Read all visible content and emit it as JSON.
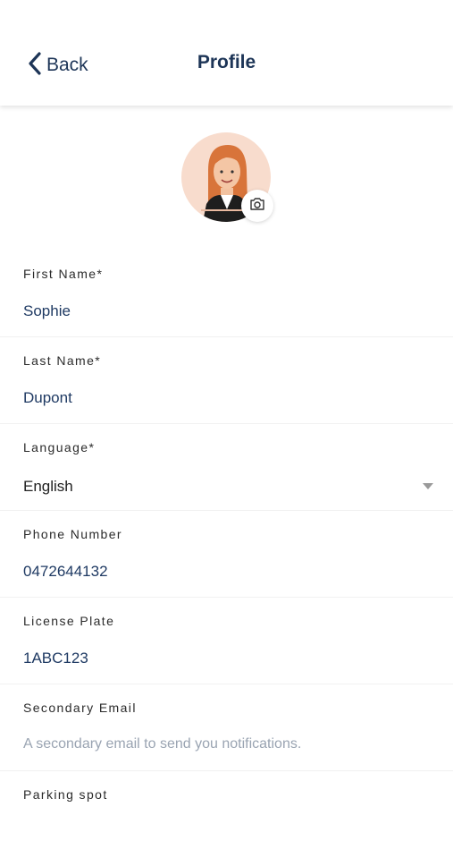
{
  "header": {
    "back_label": "Back",
    "title": "Profile"
  },
  "avatar": {
    "icon": "camera-icon"
  },
  "fields": {
    "first_name": {
      "label": "First Name*",
      "value": "Sophie"
    },
    "last_name": {
      "label": "Last Name*",
      "value": "Dupont"
    },
    "language": {
      "label": "Language*",
      "value": "English"
    },
    "phone": {
      "label": "Phone Number",
      "value": "0472644132"
    },
    "plate": {
      "label": "License Plate",
      "value": "1ABC123"
    },
    "secondary_email": {
      "label": "Secondary Email",
      "placeholder": "A secondary email to send you notifications."
    },
    "parking": {
      "label": "Parking spot"
    }
  },
  "colors": {
    "title": "#1d3557",
    "value": "#1f3a63",
    "placeholder": "#9aa4b2",
    "avatar_bg": "#f8dccd"
  }
}
